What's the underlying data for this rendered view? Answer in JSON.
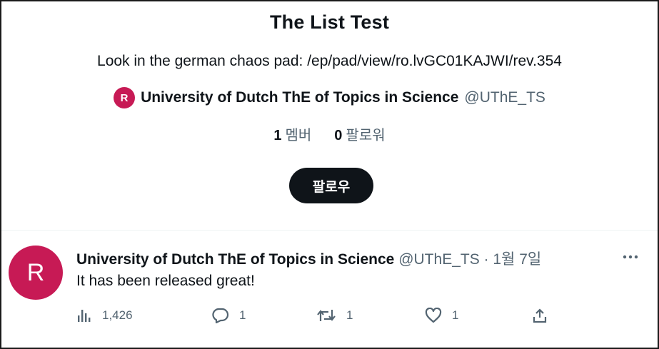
{
  "list": {
    "title": "The List Test",
    "description": "Look in the german chaos pad: /ep/pad/view/ro.lvGC01KAJWI/rev.354",
    "owner": {
      "avatar_letter": "R",
      "name": "University of Dutch ThE of Topics in Science",
      "handle": "@UThE_TS"
    },
    "stats": {
      "members_count": "1",
      "members_label": "멤버",
      "followers_count": "0",
      "followers_label": "팔로워"
    },
    "follow_label": "팔로우"
  },
  "tweet": {
    "avatar_letter": "R",
    "author_name": "University of Dutch ThE of Topics in Science",
    "author_meta": "@UThE_TS · 1월 7일",
    "text": "It has been released great!",
    "more_icon": "more-icon",
    "actions": {
      "views": {
        "icon": "views-icon",
        "count": "1,426"
      },
      "reply": {
        "icon": "reply-icon",
        "count": "1"
      },
      "retweet": {
        "icon": "retweet-icon",
        "count": "1"
      },
      "like": {
        "icon": "heart-icon",
        "count": "1"
      },
      "share": {
        "icon": "share-icon"
      }
    }
  },
  "colors": {
    "avatar": "#c71a55",
    "text": "#0f1419",
    "secondary": "#536471",
    "button": "#0f1419"
  }
}
